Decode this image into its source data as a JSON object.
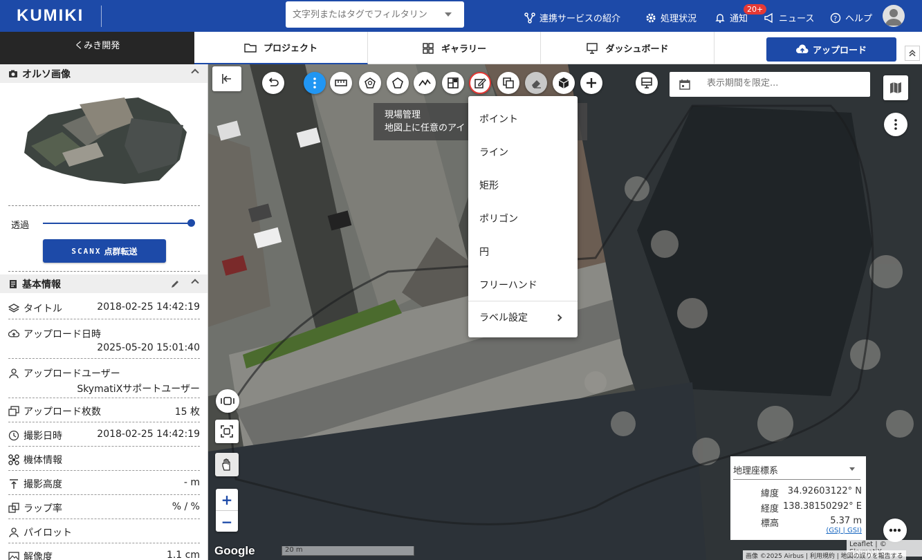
{
  "header": {
    "logo": "KUMIKI",
    "search_placeholder": "文字列またはタグでフィルタリン",
    "nav": {
      "services": "連携サービスの紹介",
      "processing": "処理状況",
      "notifications": "通知",
      "notification_badge": "20+",
      "news": "ニュース",
      "help": "ヘルプ"
    }
  },
  "tabs": {
    "company": "くみき開発",
    "project": "プロジェクト",
    "gallery": "ギャラリー",
    "dashboard": "ダッシュボード",
    "upload": "アップロード"
  },
  "left": {
    "ortho_title": "オルソ画像",
    "opacity_label": "透過",
    "opacity_value": 1.0,
    "scanx_logo": "SCANX",
    "scanx_button": "点群転送",
    "info_title": "基本情報",
    "info_rows": [
      {
        "label": "タイトル",
        "value": "2018-02-25 14:42:19"
      },
      {
        "label": "アップロード日時",
        "value": "2025-05-20 15:01:40"
      },
      {
        "label": "アップロードユーザー",
        "value": "SkymatiXサポートユーザー"
      },
      {
        "label": "アップロード枚数",
        "value": "15 枚"
      },
      {
        "label": "撮影日時",
        "value": "2018-02-25 14:42:19"
      },
      {
        "label": "機体情報",
        "value": ""
      },
      {
        "label": "撮影高度",
        "value": "- m"
      },
      {
        "label": "ラップ率",
        "value": "% / %"
      },
      {
        "label": "パイロット",
        "value": ""
      },
      {
        "label": "解像度",
        "value": "1.1 cm"
      }
    ]
  },
  "map": {
    "period_placeholder": "表示期間を限定...",
    "tooltip": {
      "line1": "現場管理",
      "line2": "地図上に任意のアイ"
    },
    "menu": [
      "ポイント",
      "ライン",
      "矩形",
      "ポリゴン",
      "円",
      "フリーハンド"
    ],
    "menu_label_setting": "ラベル設定",
    "coords": {
      "system": "地理座標系",
      "lat_label": "緯度",
      "lat_value": "34.92603122° N",
      "lng_label": "経度",
      "lng_value": "138.38150292° E",
      "alt_label": "標高",
      "alt_value": "5.37 m",
      "links": "(GSJ | GSI)"
    },
    "zoom_in": "+",
    "zoom_out": "−",
    "scale": "20 m",
    "google": "Google",
    "attribution": "Leaflet | © SkymatiX",
    "attribution2": "画像 ©2025 Airbus | 利用規約 | 地図の誤りを報告する",
    "colors": {
      "brand": "#1d4aa8",
      "active_tool": "#2196f3",
      "highlight": "#e53935"
    }
  }
}
